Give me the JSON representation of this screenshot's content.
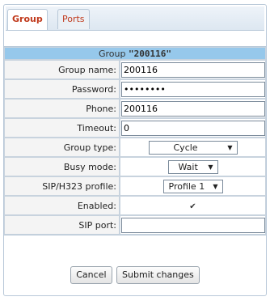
{
  "tabs": [
    {
      "label": "Group",
      "active": true
    },
    {
      "label": "Ports",
      "active": false
    }
  ],
  "form": {
    "header_prefix": "Group",
    "header_name": "\"200116\"",
    "rows": {
      "group_name": {
        "label": "Group name:",
        "value": "200116"
      },
      "password": {
        "label": "Password:",
        "value": "••••••••"
      },
      "phone": {
        "label": "Phone:",
        "value": "200116"
      },
      "timeout": {
        "label": "Timeout:",
        "value": "0"
      },
      "group_type": {
        "label": "Group type:",
        "value": "Cycle"
      },
      "busy_mode": {
        "label": "Busy mode:",
        "value": "Wait"
      },
      "sip_profile": {
        "label": "SIP/H323 profile:",
        "value": "Profile 1"
      },
      "enabled": {
        "label": "Enabled:",
        "checked": true,
        "mark": "✔"
      },
      "sip_port": {
        "label": "SIP port:",
        "value": ""
      }
    },
    "dropdown_arrow": "▼"
  },
  "buttons": {
    "cancel": "Cancel",
    "submit": "Submit changes"
  },
  "colors": {
    "tab_text": "#c0391b",
    "header_bg": "#96c8eb",
    "border": "#b8c8d8"
  }
}
